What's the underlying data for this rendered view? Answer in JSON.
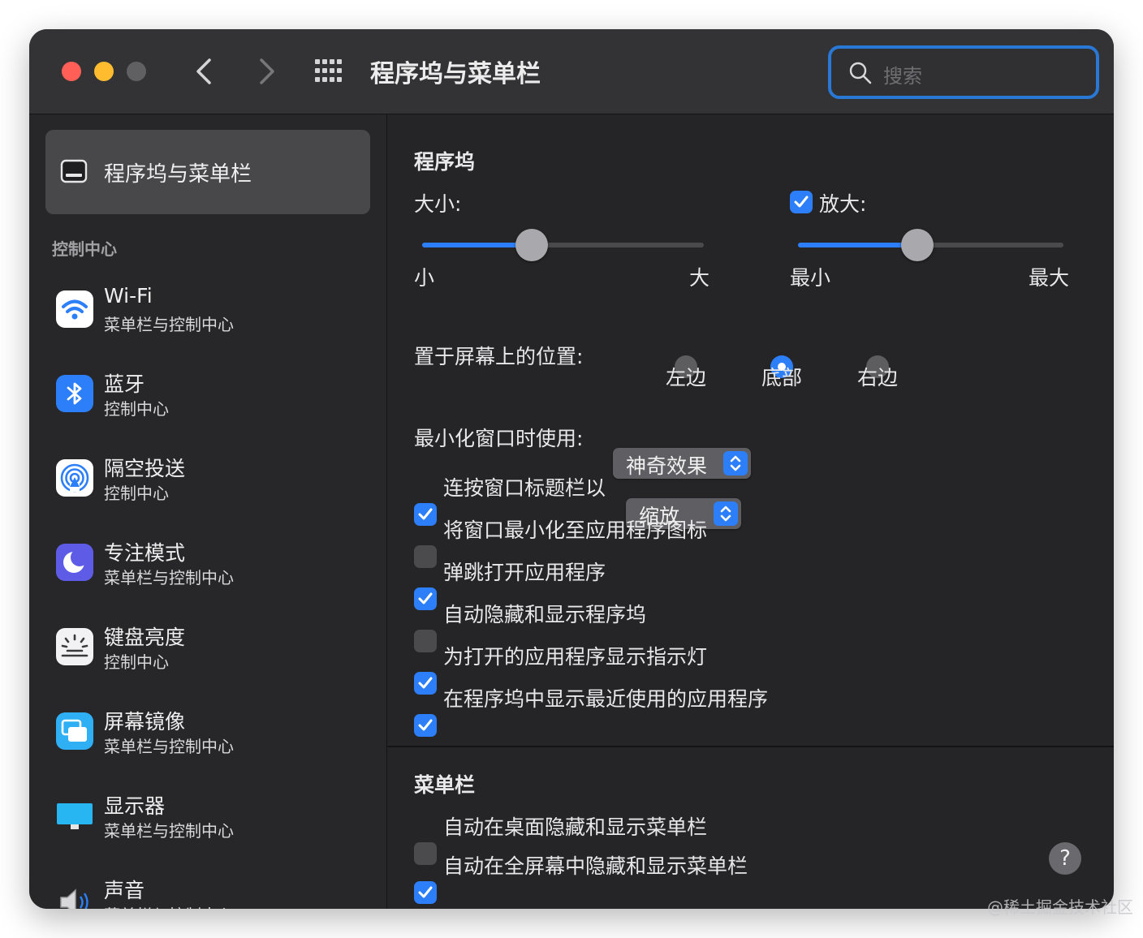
{
  "window": {
    "title": "程序坞与菜单栏",
    "search_placeholder": "搜索",
    "traffic_lights": {
      "close": "#ff5f57",
      "minimize": "#febc2e",
      "zoom": "#606063"
    }
  },
  "sidebar": {
    "selected": {
      "label": "程序坞与菜单栏",
      "icon": "dock-icon"
    },
    "section_title": "控制中心",
    "items": [
      {
        "title": "Wi-Fi",
        "subtitle": "菜单栏与控制中心",
        "icon": "wifi-icon"
      },
      {
        "title": "蓝牙",
        "subtitle": "控制中心",
        "icon": "bluetooth-icon"
      },
      {
        "title": "隔空投送",
        "subtitle": "控制中心",
        "icon": "airdrop-icon"
      },
      {
        "title": "专注模式",
        "subtitle": "菜单栏与控制中心",
        "icon": "focus-moon-icon"
      },
      {
        "title": "键盘亮度",
        "subtitle": "控制中心",
        "icon": "keyboard-brightness-icon"
      },
      {
        "title": "屏幕镜像",
        "subtitle": "菜单栏与控制中心",
        "icon": "screen-mirroring-icon"
      },
      {
        "title": "显示器",
        "subtitle": "菜单栏与控制中心",
        "icon": "display-icon"
      },
      {
        "title": "声音",
        "subtitle": "菜单栏与控制中心",
        "icon": "sound-icon"
      }
    ]
  },
  "dock": {
    "header": "程序坞",
    "size": {
      "label": "大小:",
      "min_label": "小",
      "max_label": "大",
      "value": 0.39
    },
    "magnification": {
      "label": "放大:",
      "checked": true,
      "min_label": "最小",
      "max_label": "最大",
      "value": 0.45
    },
    "position": {
      "label": "置于屏幕上的位置:",
      "options": [
        "左边",
        "底部",
        "右边"
      ],
      "selected": "底部"
    },
    "minimize_effect": {
      "label": "最小化窗口时使用:",
      "value": "神奇效果"
    },
    "double_click": {
      "label": "连按窗口标题栏以",
      "checked": true,
      "value": "缩放"
    },
    "options": [
      {
        "label": "将窗口最小化至应用程序图标",
        "checked": false
      },
      {
        "label": "弹跳打开应用程序",
        "checked": true
      },
      {
        "label": "自动隐藏和显示程序坞",
        "checked": false
      },
      {
        "label": "为打开的应用程序显示指示灯",
        "checked": true
      },
      {
        "label": "在程序坞中显示最近使用的应用程序",
        "checked": true
      }
    ]
  },
  "menubar": {
    "header": "菜单栏",
    "options": [
      {
        "label": "自动在桌面隐藏和显示菜单栏",
        "checked": false
      },
      {
        "label": "自动在全屏幕中隐藏和显示菜单栏",
        "checked": true
      }
    ]
  },
  "help_label": "?",
  "watermark": "@稀土掘金技术社区",
  "accent_color": "#2d7ff9"
}
